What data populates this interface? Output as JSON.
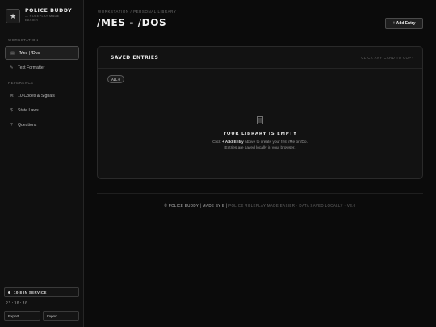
{
  "brand": {
    "title": "POLICE BUDDY",
    "subtitle": "ROLEPLAY MADE EASIER",
    "logo_icon": "star-icon"
  },
  "sidebar": {
    "sections": [
      {
        "label": "WORKSTATION"
      },
      {
        "label": "REFERENCE"
      }
    ],
    "items": [
      {
        "label": "/Mes | /Dos",
        "icon": "list-icon",
        "active": true
      },
      {
        "label": "Text Formatter",
        "icon": "pen-icon",
        "active": false
      },
      {
        "label": "10-Codes & Signals",
        "icon": "signal-icon",
        "active": false
      },
      {
        "label": "State Laws",
        "icon": "dollar-icon",
        "active": false
      },
      {
        "label": "Questions",
        "icon": "question-icon",
        "active": false
      }
    ],
    "status": "10-8 IN SERVICE",
    "clock": "23:30:30",
    "export_label": "Export",
    "import_label": "Import"
  },
  "header": {
    "breadcrumb": "WORKSTATION / PERSONAL LIBRARY",
    "title": "/MES - /DOS",
    "add_button": "+ Add Entry"
  },
  "saved": {
    "title": "SAVED ENTRIES",
    "hint": "CLICK ANY CARD TO COPY",
    "filter": "ALL 0",
    "empty_title": "YOUR LIBRARY IS EMPTY",
    "empty_prefix": "Click",
    "empty_action": "+ Add Entry",
    "empty_suffix": "above to create your first /Me or /Do.",
    "empty_line2": "Entries are saved locally in your browser."
  },
  "footer": {
    "left": "© POLICE BUDDY | MADE BY B |",
    "right": "POLICE ROLEPLAY MADE EASIER · DATA SAVED LOCALLY · V3.0"
  },
  "colors": {
    "background": "#0b0b0b",
    "sidebar": "#101010",
    "card": "#121212",
    "border": "#2a2a2a",
    "text": "#e6e6e6"
  }
}
